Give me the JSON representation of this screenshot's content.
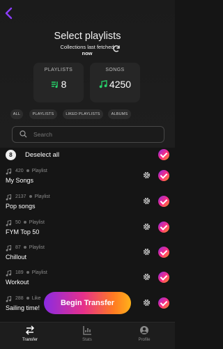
{
  "header": {
    "title": "Select playlists",
    "fetched_line1": "Collections last fetched",
    "fetched_line2": "now"
  },
  "stats": {
    "playlists_label": "PLAYLISTS",
    "playlists_value": "8",
    "songs_label": "SONGS",
    "songs_value": "4250"
  },
  "filters": [
    "ALL",
    "PLAYLISTS",
    "LIKED PLAYLISTS",
    "ALBUMS"
  ],
  "search": {
    "placeholder": "Search"
  },
  "selection": {
    "count": "8",
    "label": "Deselect all"
  },
  "playlists": [
    {
      "count": "420",
      "type": "Playlist",
      "name": "My Songs"
    },
    {
      "count": "2137",
      "type": "Playlist",
      "name": "Pop songs"
    },
    {
      "count": "50",
      "type": "Playlist",
      "name": "FYM Top 50"
    },
    {
      "count": "87",
      "type": "Playlist",
      "name": "Chillout"
    },
    {
      "count": "189",
      "type": "Playlist",
      "name": "Workout"
    },
    {
      "count": "288",
      "type": "Like",
      "name": "Sailing time!"
    }
  ],
  "cta": {
    "label": "Begin Transfer"
  },
  "nav": [
    {
      "label": "Transfer",
      "icon": "transfer-icon"
    },
    {
      "label": "Stats",
      "icon": "stats-icon"
    },
    {
      "label": "Profile",
      "icon": "profile-icon"
    }
  ],
  "colors": {
    "accent_green": "#27d36a",
    "accent_purple": "#8a2be2",
    "accent_orange": "#ff9a1f"
  }
}
